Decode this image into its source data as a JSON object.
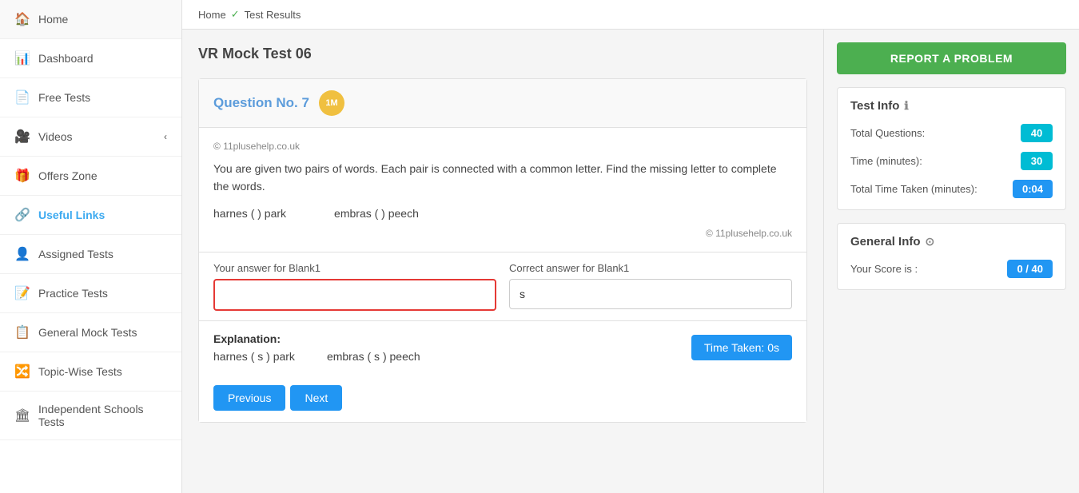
{
  "sidebar": {
    "items": [
      {
        "label": "Home",
        "icon": "🏠",
        "active": false
      },
      {
        "label": "Dashboard",
        "icon": "📊",
        "active": false
      },
      {
        "label": "Free Tests",
        "icon": "📄",
        "active": false
      },
      {
        "label": "Videos",
        "icon": "🎥",
        "active": false,
        "hasChevron": true
      },
      {
        "label": "Offers Zone",
        "icon": "🎁",
        "active": false
      },
      {
        "label": "Useful Links",
        "icon": "🔗",
        "active": true
      },
      {
        "label": "Assigned Tests",
        "icon": "👤",
        "active": false
      },
      {
        "label": "Practice Tests",
        "icon": "📝",
        "active": false
      },
      {
        "label": "General Mock Tests",
        "icon": "📋",
        "active": false
      },
      {
        "label": "Topic-Wise Tests",
        "icon": "🔀",
        "active": false
      },
      {
        "label": "Independent Schools Tests",
        "icon": "🏛",
        "active": false
      }
    ]
  },
  "breadcrumb": {
    "home": "Home",
    "check": "✓",
    "current": "Test Results"
  },
  "test": {
    "title": "VR Mock Test 06",
    "question": {
      "number": "Question No. 7",
      "badge": "1M",
      "copyright": "© 11plusehelp.co.uk",
      "text": "You are given two pairs of words. Each pair is connected with a common letter. Find the missing letter to complete the words.",
      "pair1": "harnes (  ) park",
      "pair2": "embras (  ) peech",
      "copyright_bottom": "© 11plusehelp.co.uk"
    },
    "answer": {
      "blank1_label": "Your answer for Blank1",
      "blank1_value": "",
      "correct_label": "Correct answer for Blank1",
      "correct_value": "s"
    },
    "explanation": {
      "title": "Explanation:",
      "words1": "harnes ( s ) park",
      "words2": "embras ( s ) peech",
      "time_taken": "Time Taken: 0s"
    },
    "nav": {
      "previous": "Previous",
      "next": "Next"
    }
  },
  "right_panel": {
    "report_btn": "REPORT A PROBLEM",
    "test_info": {
      "title": "Test Info",
      "total_questions_label": "Total Questions:",
      "total_questions_value": "40",
      "time_label": "Time (minutes):",
      "time_value": "30",
      "time_taken_label": "Total Time Taken (minutes):",
      "time_taken_value": "0:04"
    },
    "general_info": {
      "title": "General Info",
      "score_label": "Your Score is :",
      "score_value": "0 / 40"
    }
  }
}
